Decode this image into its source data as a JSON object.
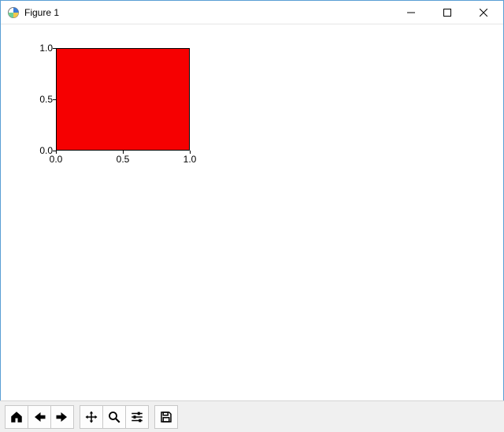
{
  "window": {
    "title": "Figure 1"
  },
  "toolbar": {
    "home": "Home",
    "back": "Back",
    "forward": "Forward",
    "pan": "Pan",
    "zoom": "Zoom",
    "configure": "Configure subplots",
    "save": "Save"
  },
  "chart_data": {
    "type": "area",
    "title": "",
    "xlabel": "",
    "ylabel": "",
    "xlim": [
      0.0,
      1.0
    ],
    "ylim": [
      0.0,
      1.0
    ],
    "xticks": [
      0.0,
      0.5,
      1.0
    ],
    "yticks": [
      0.0,
      0.5,
      1.0
    ],
    "xtick_labels": [
      "0.0",
      "0.5",
      "1.0"
    ],
    "ytick_labels": [
      "0.0",
      "0.5",
      "1.0"
    ],
    "fill": {
      "x0": 0.0,
      "x1": 1.0,
      "y0": 0.0,
      "y1": 1.0,
      "color": "#f60001"
    }
  }
}
